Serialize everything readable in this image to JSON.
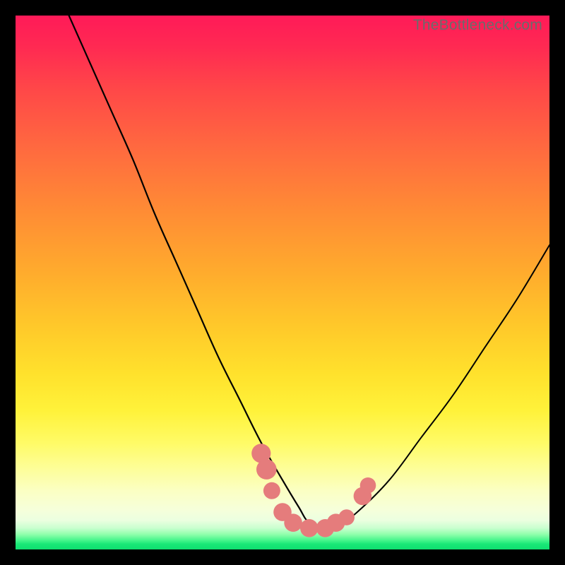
{
  "watermark": "TheBottleneck.com",
  "colors": {
    "frame": "#000000",
    "gradient_top": "#ff1a58",
    "gradient_mid": "#ffd82c",
    "gradient_bottom": "#0fdf70",
    "curve": "#000000",
    "markers": "#e57c7c"
  },
  "chart_data": {
    "type": "line",
    "title": "",
    "xlabel": "",
    "ylabel": "",
    "xlim": [
      0,
      100
    ],
    "ylim": [
      0,
      100
    ],
    "grid": false,
    "note": "No axes, ticks, labels, or legend are rendered in the image. x and y are normalized 0–100 based on plot area. Curve is a V-shape with minimum near x≈55, y≈4; left branch reaches top edge near x≈10; right branch exits right edge near y≈57. Pink markers cluster near the trough.",
    "series": [
      {
        "name": "curve",
        "x": [
          10,
          14,
          18,
          22,
          26,
          30,
          34,
          38,
          42,
          46,
          50,
          53,
          55,
          58,
          61,
          64,
          70,
          76,
          82,
          88,
          94,
          100
        ],
        "y": [
          100,
          91,
          82,
          73,
          63,
          54,
          45,
          36,
          28,
          20,
          13,
          8,
          5,
          4,
          5,
          7,
          13,
          21,
          29,
          38,
          47,
          57
        ]
      }
    ],
    "markers": [
      {
        "x": 46,
        "y": 18,
        "r": 2.0
      },
      {
        "x": 47,
        "y": 15,
        "r": 2.2
      },
      {
        "x": 48,
        "y": 11,
        "r": 1.6
      },
      {
        "x": 50,
        "y": 7,
        "r": 1.8
      },
      {
        "x": 52,
        "y": 5,
        "r": 1.8
      },
      {
        "x": 55,
        "y": 4,
        "r": 1.8
      },
      {
        "x": 58,
        "y": 4,
        "r": 1.8
      },
      {
        "x": 60,
        "y": 5,
        "r": 1.8
      },
      {
        "x": 62,
        "y": 6,
        "r": 1.4
      },
      {
        "x": 65,
        "y": 10,
        "r": 1.8
      },
      {
        "x": 66,
        "y": 12,
        "r": 1.4
      }
    ]
  }
}
